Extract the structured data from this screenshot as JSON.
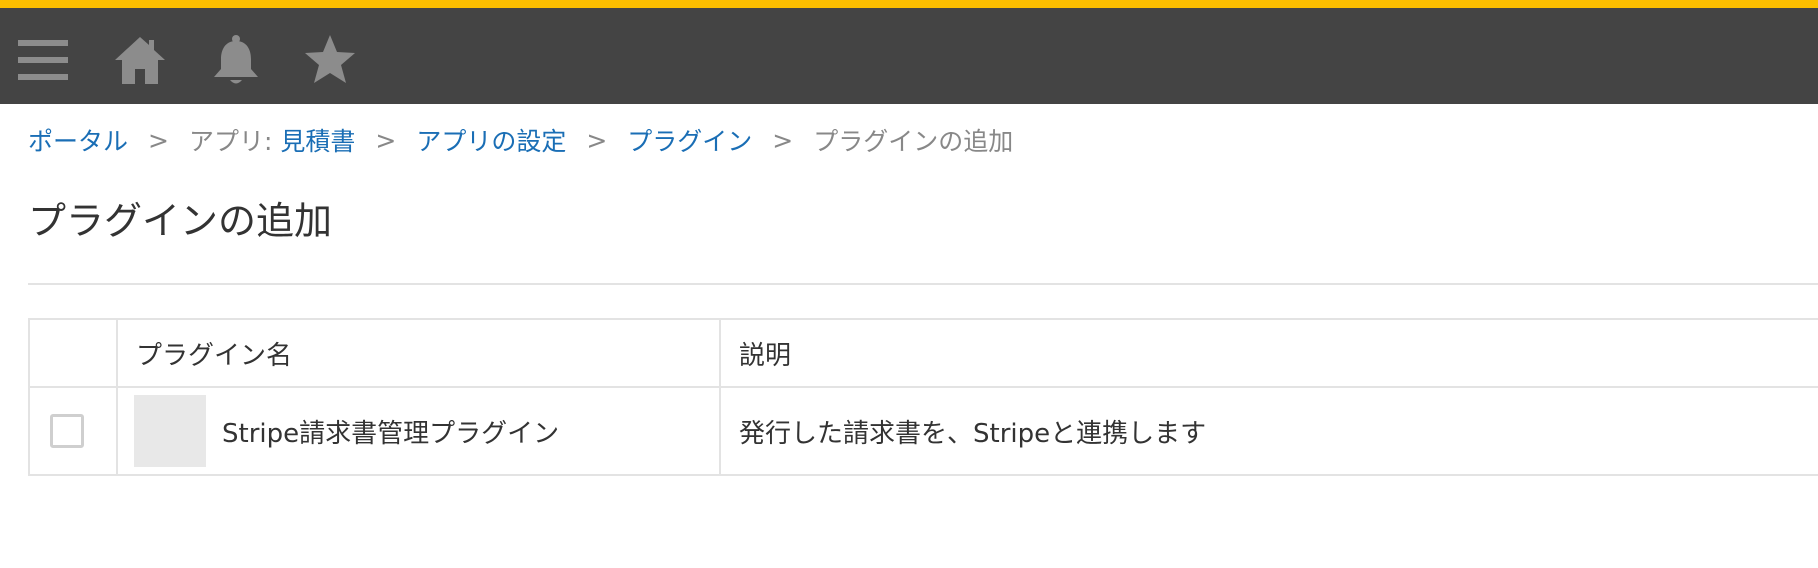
{
  "header": {
    "accent_color": "#fcbe00",
    "background_color": "#444444",
    "icons": [
      "menu-icon",
      "home-icon",
      "bell-icon",
      "star-icon"
    ]
  },
  "breadcrumb": {
    "portal": "ポータル",
    "app_prefix": "アプリ: ",
    "app_name": "見積書",
    "app_settings": "アプリの設定",
    "plugins": "プラグイン",
    "current": "プラグインの追加",
    "separator": ">"
  },
  "page": {
    "title": "プラグインの追加"
  },
  "table": {
    "columns": [
      "",
      "プラグイン名",
      "説明"
    ],
    "rows": [
      {
        "checked": false,
        "name": "Stripe請求書管理プラグイン",
        "description": "発行した請求書を、Stripeと連携します"
      }
    ]
  }
}
